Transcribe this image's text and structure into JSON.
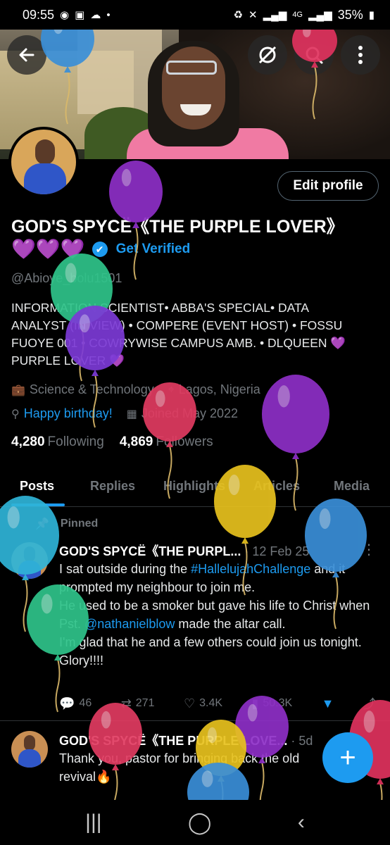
{
  "status_bar": {
    "time": "09:55",
    "battery": "35%",
    "network": "4G",
    "left_icons": [
      "whatsapp-icon",
      "gallery-icon",
      "cloud-icon",
      "dot-icon"
    ],
    "right_icons": [
      "battery-saver-icon",
      "mute-icon",
      "signal-icon",
      "signal-icon",
      "battery-icon"
    ]
  },
  "header": {
    "buttons": [
      "back-arrow-icon",
      "sync-off-icon",
      "search-icon",
      "more-vertical-icon"
    ]
  },
  "profile": {
    "edit_label": "Edit profile",
    "display_name": "GOD'S SPYCË《THE PURPLE LOVER》",
    "hearts": "💜💜💜",
    "get_verified": "Get Verified",
    "handle": "@Abioye_bolu1501",
    "bio": "INFORMATION SCIENTIST• ABBA'S SPECIAL• DATA ANALYST (IN VIEW) • COMPERE (EVENT HOST) • FOSSU FUOYE 001 • COWRYWISE CAMPUS AMB. • DLQUEEN 💜 PURPLE LOVER 💜",
    "category": "Science & Technology",
    "location": "Lagos, Nigeria",
    "birthday": "Happy birthday!",
    "joined": "Joined May 2022",
    "following_count": "4,280",
    "following_label": "Following",
    "followers_count": "4,869",
    "followers_label": "Followers"
  },
  "tabs": [
    "Posts",
    "Replies",
    "Highlights",
    "Articles",
    "Media"
  ],
  "tweets": [
    {
      "pinned_label": "Pinned",
      "author": "GOD'S SPYCË《THE PURPL...",
      "meta": "· 12 Feb 25",
      "text_before_tag": "I sat outside during the ",
      "hashtag": "#HallelujahChallenge",
      "text_after_tag": " and it prompted my neighbour to join me.",
      "line2_before": "He used to be a smoker but gave his life to Christ when Pst. ",
      "mention": "@nathanielblow",
      "line2_after": " made the altar call.",
      "line3": "I'm glad that he and a few others could join us tonight.",
      "line4": "Glory!!!!",
      "replies": "46",
      "reposts": "271",
      "likes": "3.4K",
      "views": "50.3K"
    },
    {
      "author": "GOD'S SPYCË《THE PURPLE LOVE...",
      "meta": "· 5d",
      "text": "Thank you, pastor for bringing back the old revival🔥"
    }
  ],
  "fab_label": "+",
  "nav": [
    "recent-apps-icon",
    "home-icon",
    "back-icon"
  ],
  "colors": {
    "accent": "#1d9bf0",
    "background": "#000000",
    "muted_text": "#71767b",
    "heart_purple": "#b23bdf"
  },
  "balloon_colors": [
    "#3a8fd8",
    "#e0325e",
    "#8e2fc7",
    "#2fc48a",
    "#7c3ad6",
    "#e13b61",
    "#8e2fc7",
    "#e8c21e",
    "#3a8fd8",
    "#2fb5d8",
    "#2fc48a",
    "#e13b61",
    "#8e2fc7",
    "#e8c21e"
  ]
}
